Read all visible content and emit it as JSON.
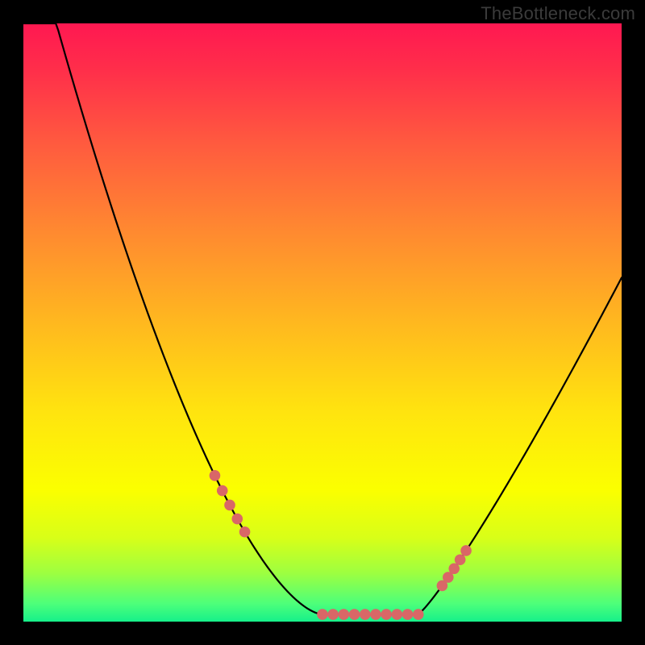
{
  "watermark": "TheBottleneck.com",
  "colors": {
    "background": "#000000",
    "curve": "#000000",
    "marker_fill": "#d96767",
    "marker_stroke": "#c24f4f"
  },
  "chart_data": {
    "type": "line",
    "title": "",
    "xlabel": "",
    "ylabel": "",
    "x": [
      0.0,
      0.05,
      0.1,
      0.15,
      0.2,
      0.25,
      0.3,
      0.35,
      0.4,
      0.45,
      0.5,
      0.55,
      0.6,
      0.65,
      0.7,
      0.75,
      0.8,
      0.85,
      0.9,
      0.95,
      1.0
    ],
    "y": [
      1.0,
      0.9,
      0.8,
      0.7,
      0.6,
      0.5,
      0.4,
      0.3,
      0.2,
      0.1,
      0.02,
      0.0,
      0.0,
      0.02,
      0.08,
      0.18,
      0.27,
      0.35,
      0.43,
      0.5,
      0.57
    ],
    "xlim": [
      0,
      1
    ],
    "ylim": [
      0,
      1
    ],
    "minimum_region_x": [
      0.5,
      0.66
    ],
    "marker_clusters": [
      {
        "x_range": [
          0.32,
          0.37
        ],
        "n": 5
      },
      {
        "x_range": [
          0.5,
          0.66
        ],
        "n": 10
      },
      {
        "x_range": [
          0.7,
          0.74
        ],
        "n": 5
      }
    ]
  }
}
